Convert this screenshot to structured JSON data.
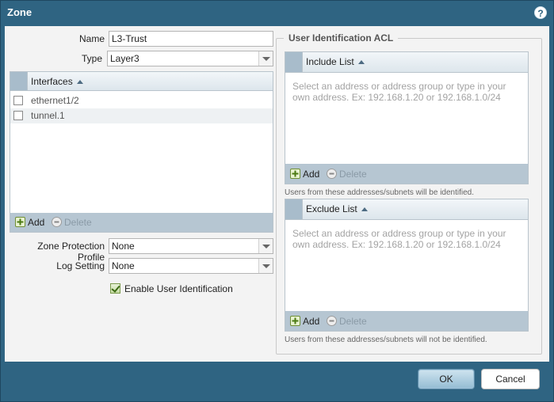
{
  "dialog": {
    "title": "Zone",
    "help_icon": "help-icon"
  },
  "form": {
    "name_label": "Name",
    "name_value": "L3-Trust",
    "type_label": "Type",
    "type_value": "Layer3",
    "zone_protection_label": "Zone Protection Profile",
    "zone_protection_value": "None",
    "log_setting_label": "Log Setting",
    "log_setting_value": "None",
    "enable_user_id_label": "Enable User Identification",
    "enable_user_id_checked": true
  },
  "interfaces": {
    "header": "Interfaces",
    "rows": [
      "ethernet1/2",
      "tunnel.1"
    ],
    "add_label": "Add",
    "delete_label": "Delete"
  },
  "user_id_acl": {
    "legend": "User Identification ACL",
    "include": {
      "header": "Include List",
      "placeholder": "Select an address or address group or type in your own address. Ex: 192.168.1.20 or 192.168.1.0/24",
      "add_label": "Add",
      "delete_label": "Delete",
      "hint": "Users from these addresses/subnets will be identified."
    },
    "exclude": {
      "header": "Exclude List",
      "placeholder": "Select an address or address group or type in your own address. Ex: 192.168.1.20 or 192.168.1.0/24",
      "add_label": "Add",
      "delete_label": "Delete",
      "hint": "Users from these addresses/subnets will not be identified."
    }
  },
  "buttons": {
    "ok": "OK",
    "cancel": "Cancel"
  },
  "colors": {
    "titlebar": "#2f6482",
    "grid_header_sel": "#a8bccb",
    "grid_footer": "#b6c6d2",
    "ok_button": "#94bcd3"
  }
}
